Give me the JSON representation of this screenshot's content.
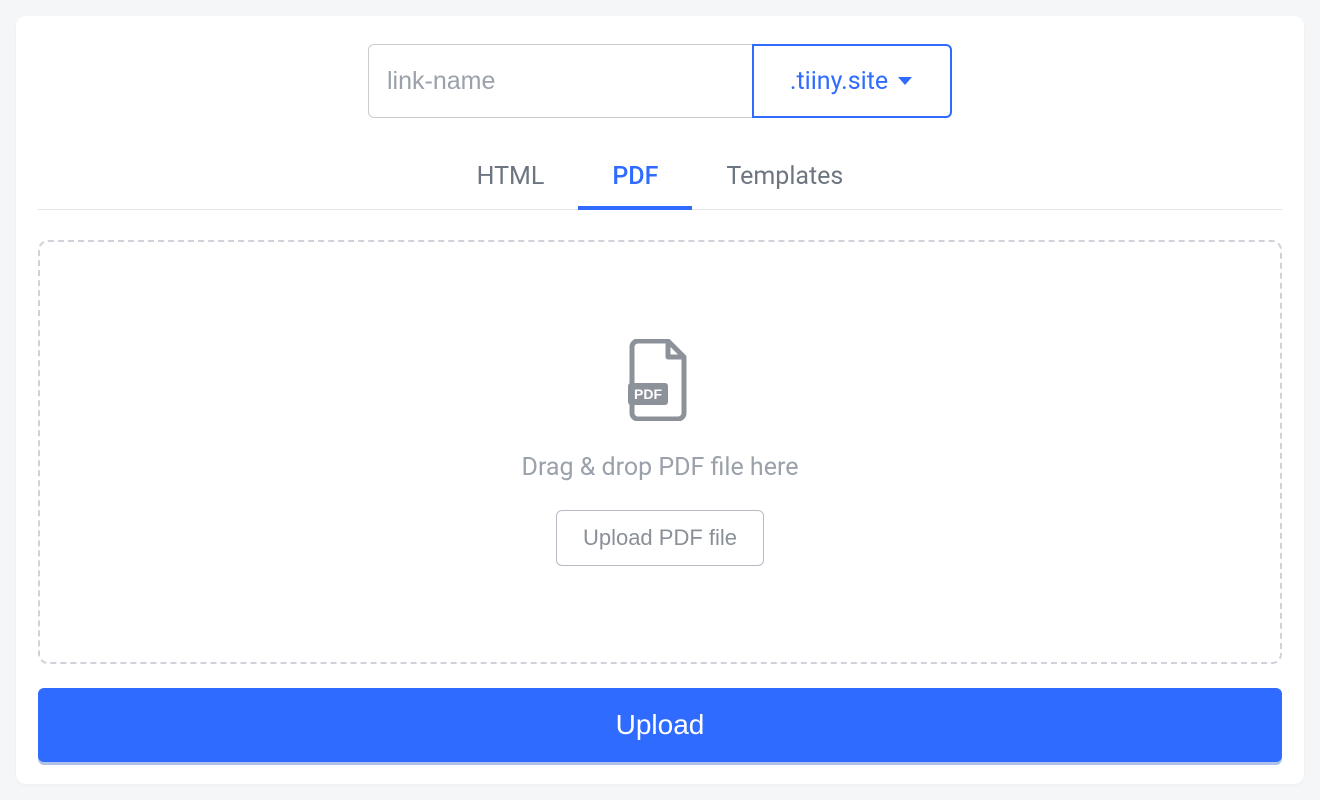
{
  "url_input": {
    "placeholder": "link-name",
    "value": ""
  },
  "domain_select": {
    "label": ".tiiny.site"
  },
  "tabs": [
    {
      "label": "HTML",
      "active": false
    },
    {
      "label": "PDF",
      "active": true
    },
    {
      "label": "Templates",
      "active": false
    }
  ],
  "dropzone": {
    "instruction": "Drag & drop PDF file here",
    "upload_file_label": "Upload PDF file",
    "icon_badge": "PDF"
  },
  "submit": {
    "label": "Upload"
  }
}
